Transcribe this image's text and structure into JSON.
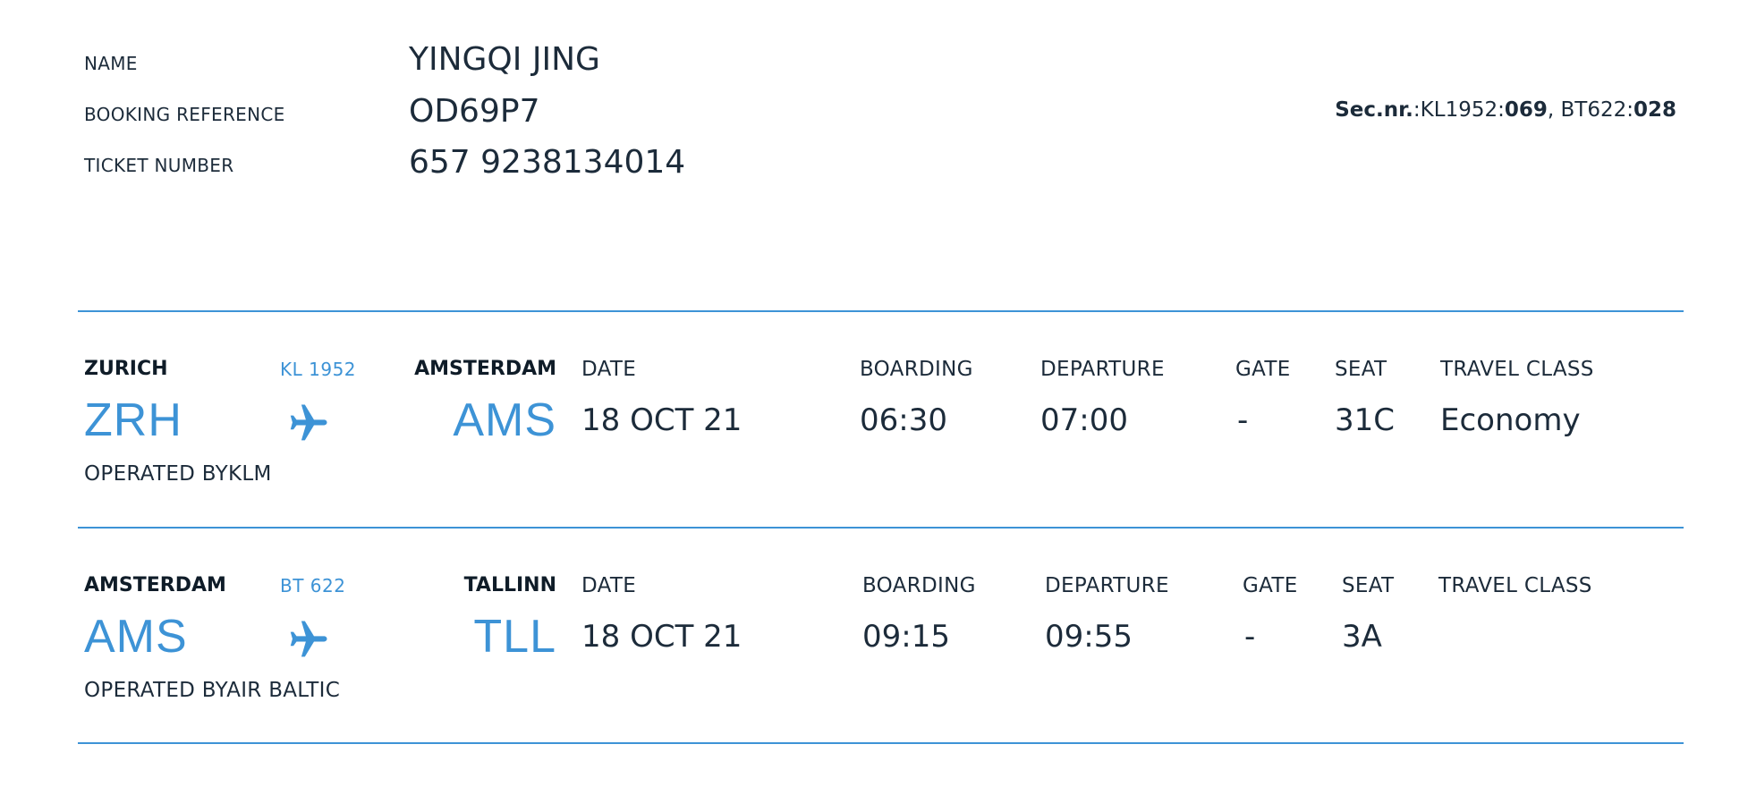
{
  "passenger": {
    "name_label": "NAME",
    "name_value": "YINGQI JING",
    "booking_label": "BOOKING REFERENCE",
    "booking_value": "OD69P7",
    "ticket_label": "TICKET NUMBER",
    "ticket_value": "657 9238134014"
  },
  "sec_nr": {
    "label": "Sec.nr.",
    "sep": ":",
    "f1_code": "KL1952",
    "f1_seq": "069",
    "comma": ", ",
    "f2_code": "BT622",
    "f2_seq": "028"
  },
  "column_labels": {
    "date": "DATE",
    "boarding": "BOARDING",
    "departure": "DEPARTURE",
    "gate": "GATE",
    "seat": "SEAT",
    "travel_class": "TRAVEL CLASS"
  },
  "flights": [
    {
      "origin_city": "ZURICH",
      "origin_code": "ZRH",
      "flight_number": "KL 1952",
      "destination_city": "AMSTERDAM",
      "destination_code": "AMS",
      "date": "18 OCT 21",
      "boarding": "06:30",
      "departure": "07:00",
      "gate": "-",
      "seat": "31C",
      "travel_class": "Economy",
      "operated_by": "OPERATED BYKLM"
    },
    {
      "origin_city": "AMSTERDAM",
      "origin_code": "AMS",
      "flight_number": "BT 622",
      "destination_city": "TALLINN",
      "destination_code": "TLL",
      "date": "18 OCT 21",
      "boarding": "09:15",
      "departure": "09:55",
      "gate": "-",
      "seat": "3A",
      "travel_class": "",
      "operated_by": "OPERATED BYAIR BALTIC"
    }
  ],
  "icons": {
    "plane": "airplane-icon"
  },
  "colors": {
    "accent": "#3d93d6",
    "text": "#1c2b3a"
  }
}
